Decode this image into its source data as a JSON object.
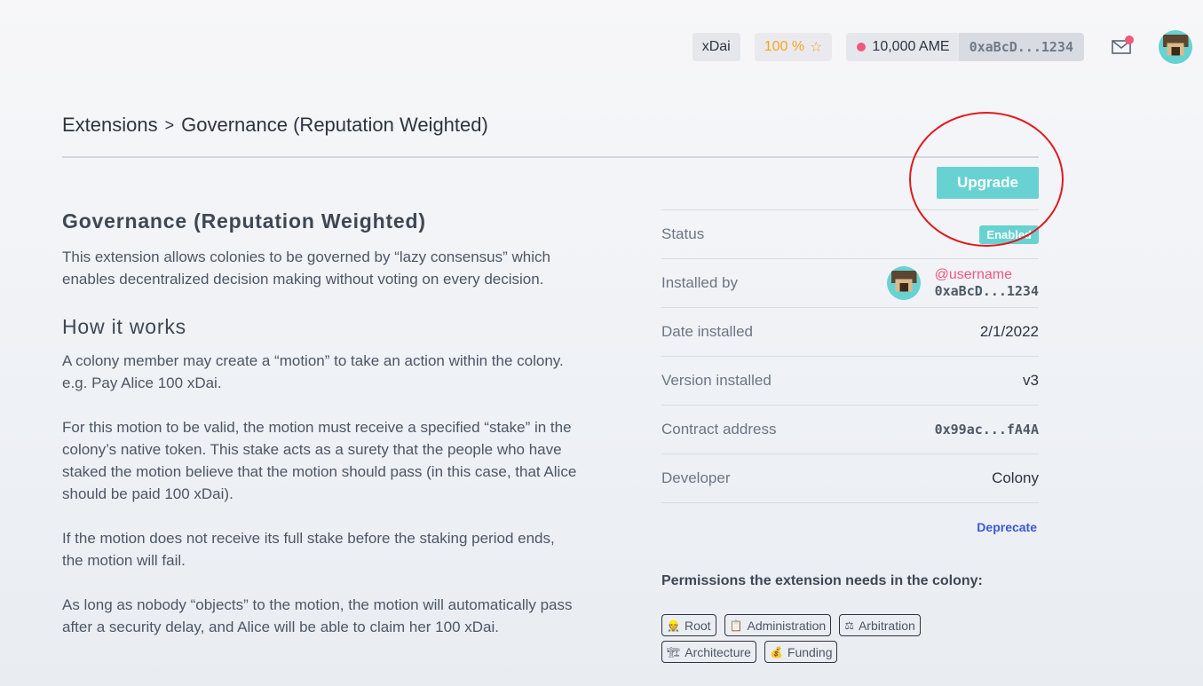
{
  "topbar": {
    "network": "xDai",
    "reputation": "100 %",
    "reputation_icon": "star-icon",
    "balance": "10,000 AME",
    "address": "0xaBcD...1234",
    "status_dot_color": "#f0587e"
  },
  "breadcrumb": {
    "parent": "Extensions",
    "separator": ">",
    "current": "Governance (Reputation Weighted)"
  },
  "content": {
    "title": "Governance (Reputation Weighted)",
    "intro": "This extension allows colonies to be governed by “lazy consensus” which enables decentralized decision making without voting on every decision.",
    "how_title": "How it works",
    "paragraphs": [
      "A colony member may create a “motion” to take an action within the colony. e.g. Pay Alice 100 xDai.",
      "For this motion to be valid, the motion must receive a specified “stake” in the colony’s native token. This stake acts as a surety that the people who have staked the motion believe that the motion should pass (in this case, that Alice should be paid 100 xDai).",
      "If the motion does not receive its full stake before the staking period ends, the motion will fail.",
      "As long as nobody “objects” to the motion, the motion will automatically pass after a security delay, and Alice will be able to claim her 100 xDai."
    ]
  },
  "panel": {
    "upgrade_label": "Upgrade",
    "status_label": "Status",
    "status_value": "Enabled",
    "installed_by_label": "Installed by",
    "installed_by_username": "@username",
    "installed_by_address": "0xaBcD...1234",
    "date_label": "Date installed",
    "date_value": "2/1/2022",
    "version_label": "Version installed",
    "version_value": "v3",
    "contract_label": "Contract address",
    "contract_value": "0x99ac...fA4A",
    "developer_label": "Developer",
    "developer_value": "Colony",
    "deprecate_label": "Deprecate",
    "permissions_title": "Permissions the extension needs in the colony:",
    "permissions": [
      {
        "label": "Root",
        "icon": "👷"
      },
      {
        "label": "Administration",
        "icon": "📋"
      },
      {
        "label": "Arbitration",
        "icon": "⚖"
      },
      {
        "label": "Architecture",
        "icon": "🏗"
      },
      {
        "label": "Funding",
        "icon": "💰"
      }
    ]
  },
  "colors": {
    "accent": "#68d2d2",
    "pink": "#f0587e",
    "link": "#3c56d8",
    "annotation_ring": "#e0191f"
  }
}
